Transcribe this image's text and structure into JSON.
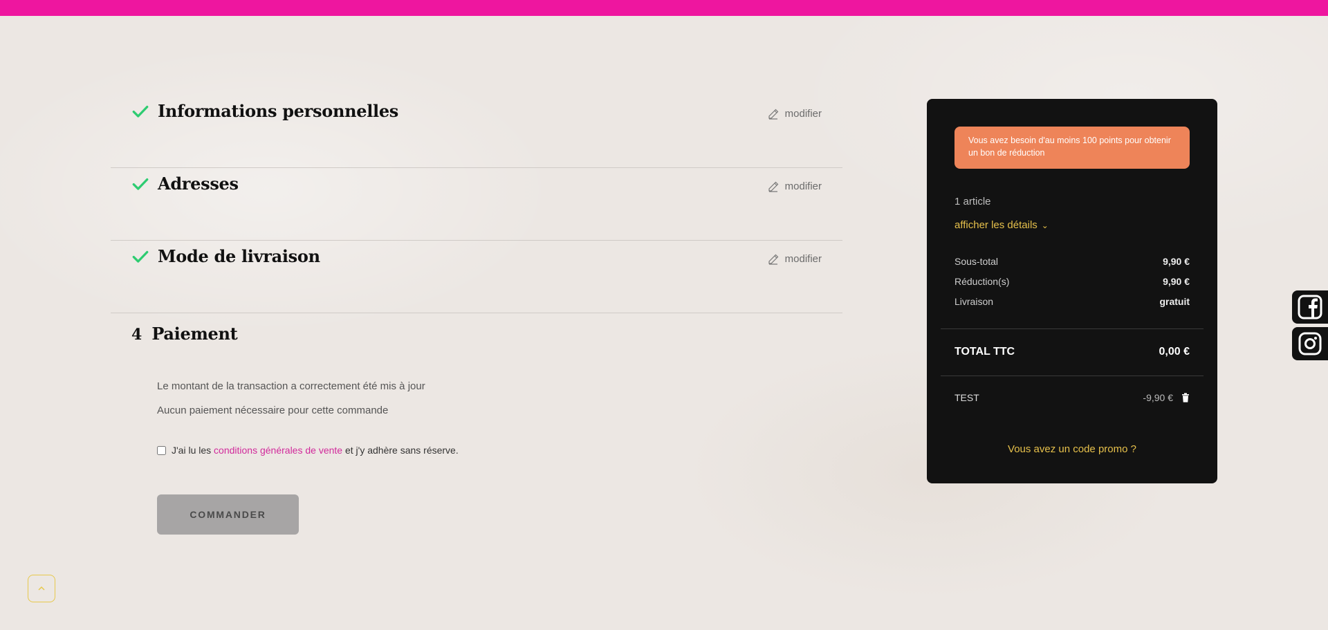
{
  "steps": [
    {
      "title": "Informations personnelles",
      "edit": "modifier"
    },
    {
      "title": "Adresses",
      "edit": "modifier"
    },
    {
      "title": "Mode de livraison",
      "edit": "modifier"
    }
  ],
  "payment": {
    "number": "4",
    "title": "Paiement",
    "message1": "Le montant de la transaction a correctement été mis à jour",
    "message2": "Aucun paiement nécessaire pour cette commande",
    "terms_prefix": "J'ai lu les",
    "terms_link": "conditions générales de vente",
    "terms_suffix": "et j'y adhère sans réserve.",
    "order_button": "COMMANDER"
  },
  "summary": {
    "alert": "Vous avez besoin d'au moins 100 points pour obtenir un bon de réduction",
    "count": "1 article",
    "details": "afficher les détails",
    "subtotal_label": "Sous-total",
    "subtotal_value": "9,90 €",
    "discount_label": "Réduction(s)",
    "discount_value": "9,90 €",
    "shipping_label": "Livraison",
    "shipping_value": "gratuit",
    "total_label": "TOTAL TTC",
    "total_value": "0,00 €",
    "voucher_name": "TEST",
    "voucher_value": "-9,90 €",
    "promo": "Vous avez un code promo ?"
  },
  "colors": {
    "topbar": "#ee169f",
    "check": "#2ecc71",
    "accent_gold": "#e6c04b",
    "alert_bg": "#ee8459",
    "panel_bg": "#121212",
    "link": "#d12a9b"
  },
  "icons": {
    "check": "check-icon",
    "edit": "pencil-icon",
    "trash": "trash-icon",
    "facebook": "facebook-icon",
    "instagram": "instagram-icon",
    "back_to_top": "chevron-up-icon"
  }
}
